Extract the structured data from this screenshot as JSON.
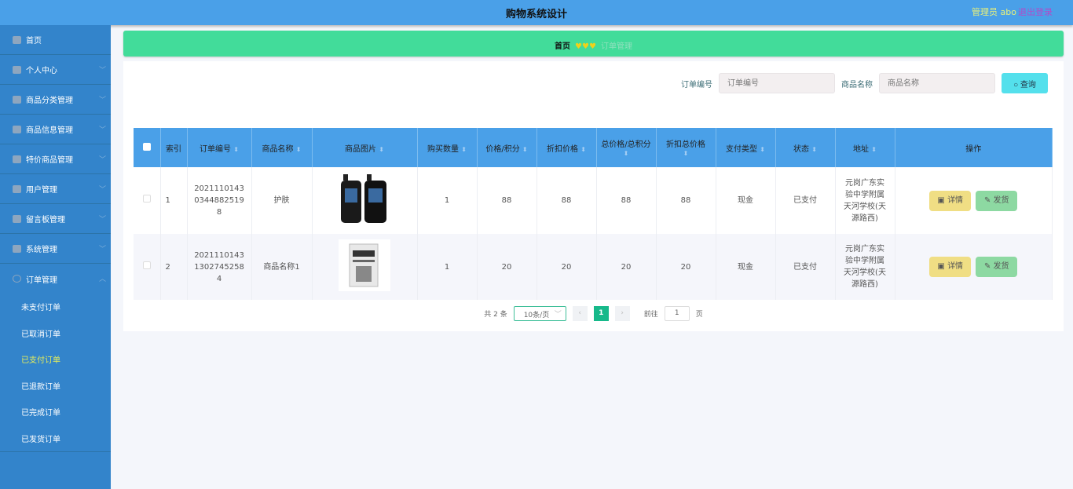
{
  "header": {
    "title": "购物系统设计",
    "user": "管理员 abo",
    "logout": "退出登录"
  },
  "sidebar": {
    "items": [
      {
        "label": "首页"
      },
      {
        "label": "个人中心"
      },
      {
        "label": "商品分类管理"
      },
      {
        "label": "商品信息管理"
      },
      {
        "label": "特价商品管理"
      },
      {
        "label": "用户管理"
      },
      {
        "label": "留言板管理"
      },
      {
        "label": "系统管理"
      },
      {
        "label": "订单管理"
      }
    ],
    "submenu": [
      "未支付订单",
      "已取消订单",
      "已支付订单",
      "已退款订单",
      "已完成订单",
      "已发货订单"
    ],
    "active_sub": "已支付订单"
  },
  "breadcrumb": {
    "home": "首页",
    "hearts": "♥♥♥",
    "current": "订单管理"
  },
  "search": {
    "order_label": "订单编号",
    "order_placeholder": "订单编号",
    "name_label": "商品名称",
    "name_placeholder": "商品名称",
    "button": "查询"
  },
  "table": {
    "headers": [
      "索引",
      "订单编号",
      "商品名称",
      "商品图片",
      "购买数量",
      "价格/积分",
      "折扣价格",
      "总价格/总积分",
      "折扣总价格",
      "支付类型",
      "状态",
      "地址",
      "操作"
    ],
    "rows": [
      {
        "index": "1",
        "order_no": "202111014303448825198",
        "name": "护肤",
        "qty": "1",
        "price": "88",
        "discount": "88",
        "total": "88",
        "discount_total": "88",
        "pay": "现金",
        "status": "已支付",
        "address": "元岗广东实验中学附属天河学校(天源路西)"
      },
      {
        "index": "2",
        "order_no": "202111014313027452584",
        "name": "商品名称1",
        "qty": "1",
        "price": "20",
        "discount": "20",
        "total": "20",
        "discount_total": "20",
        "pay": "现金",
        "status": "已支付",
        "address": "元岗广东实验中学附属天河学校(天源路西)"
      }
    ],
    "detail_btn": "详情",
    "ship_btn": "发货"
  },
  "pager": {
    "total": "共 2 条",
    "size": "10条/页",
    "page": "1",
    "goto": "前往",
    "goto_val": "1",
    "page_unit": "页"
  }
}
